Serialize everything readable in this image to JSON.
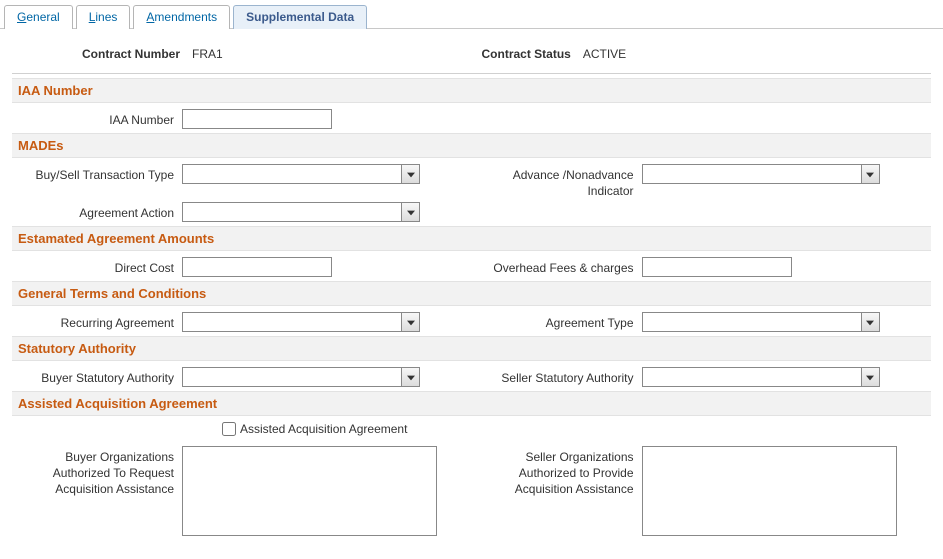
{
  "tabs": {
    "general": {
      "prefix": "G",
      "rest": "eneral"
    },
    "lines": {
      "prefix": "L",
      "rest": "ines"
    },
    "amendments": {
      "prefix": "A",
      "rest": "mendments"
    },
    "supplemental": "Supplemental Data"
  },
  "header": {
    "contract_number_label": "Contract Number",
    "contract_number_value": "FRA1",
    "contract_status_label": "Contract Status",
    "contract_status_value": "ACTIVE"
  },
  "sections": {
    "iaa": {
      "title": "IAA Number",
      "iaa_number_label": "IAA Number",
      "iaa_number_value": ""
    },
    "mades": {
      "title": "MADEs",
      "buy_sell_label": "Buy/Sell Transaction Type",
      "buy_sell_value": "",
      "advance_label": "Advance /Nonadvance Indicator",
      "advance_value": "",
      "agreement_action_label": "Agreement Action",
      "agreement_action_value": ""
    },
    "amounts": {
      "title": "Estamated Agreement Amounts",
      "direct_cost_label": "Direct Cost",
      "direct_cost_value": "",
      "overhead_label": "Overhead Fees & charges",
      "overhead_value": ""
    },
    "terms": {
      "title": "General Terms and Conditions",
      "recurring_label": "Recurring Agreement",
      "recurring_value": "",
      "agreement_type_label": "Agreement Type",
      "agreement_type_value": ""
    },
    "statutory": {
      "title": "Statutory Authority",
      "buyer_label": "Buyer Statutory Authority",
      "buyer_value": "",
      "seller_label": "Seller Statutory Authority",
      "seller_value": ""
    },
    "assisted": {
      "title": "Assisted Acquisition Agreement",
      "checkbox_label": "Assisted Acquisition Agreement",
      "checkbox_checked": false,
      "buyer_org_label": "Buyer Organizations Authorized To Request Acquisition Assistance",
      "buyer_org_value": "",
      "seller_org_label": "Seller Organizations Authorized to Provide Acquisition Assistance",
      "seller_org_value": ""
    }
  }
}
